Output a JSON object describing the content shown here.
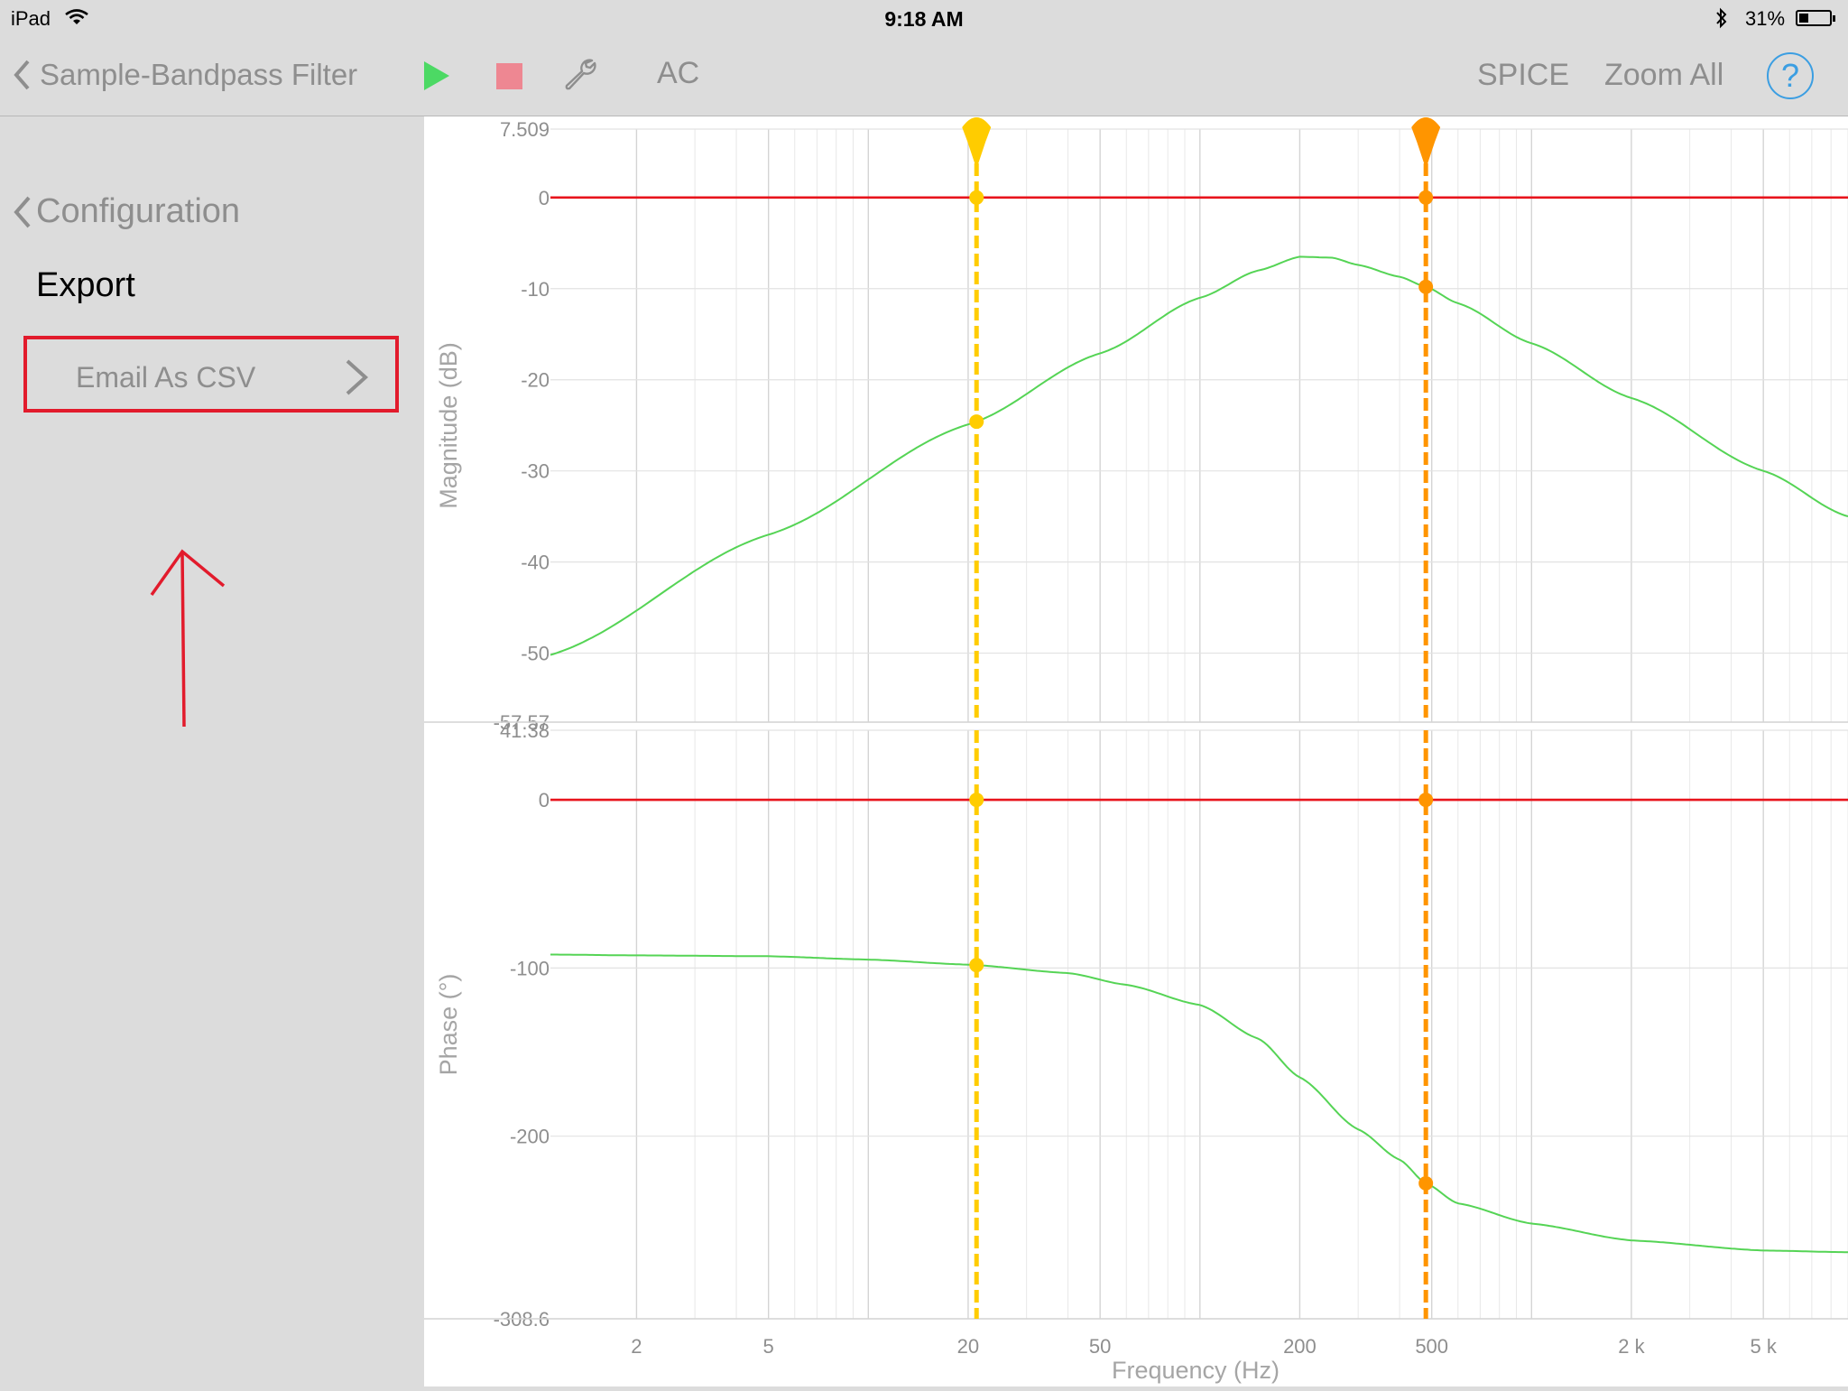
{
  "status_bar": {
    "device": "iPad",
    "time": "9:18 AM",
    "battery_percent": "31%"
  },
  "nav": {
    "back_label": "Sample-Bandpass Filter",
    "mode_label": "AC",
    "spice_label": "SPICE",
    "zoom_label": "Zoom All",
    "help_symbol": "?"
  },
  "sidebar": {
    "back_label": "Configuration",
    "section_title": "Export",
    "items": [
      {
        "label": "Email As CSV"
      }
    ]
  },
  "colors": {
    "trace": "#55d455",
    "zero_line": "#e8141c",
    "cursor_1": "#ffcc00",
    "cursor_2": "#ff9500",
    "annotation": "#e21b2c",
    "accent": "#3b9ee2"
  },
  "icons": {
    "back": "chevron-left-icon",
    "run": "play-icon",
    "stop": "stop-icon",
    "settings": "wrench-icon",
    "help": "question-circle-icon",
    "menu_chevron": "chevron-right-icon"
  },
  "chart_data": [
    {
      "type": "line",
      "ylabel": "Magnitude (dB)",
      "xlabel": "Frequency (Hz)",
      "xscale": "log",
      "xlim": [
        1.1,
        9000
      ],
      "ylim": [
        -57.57,
        7.509
      ],
      "y_ticks": [
        7.509,
        0,
        -10,
        -20,
        -30,
        -40,
        -50,
        -57.57
      ],
      "y_tick_labels": [
        "7.509",
        "0",
        "-10",
        "-20",
        "-30",
        "-40",
        "-50",
        "-57.57"
      ],
      "grid": true,
      "reference_line_y": 0,
      "cursors_x": [
        21.2,
        480
      ],
      "series": [
        {
          "x": [
            1.1,
            5,
            20,
            50,
            100,
            150,
            200,
            250,
            300,
            400,
            480,
            600,
            1000,
            2000,
            5000,
            9000
          ],
          "y": [
            -50.2,
            -37.0,
            -24.9,
            -17.1,
            -11.0,
            -8.0,
            -6.5,
            -6.6,
            -7.4,
            -8.7,
            -9.8,
            -11.6,
            -16.0,
            -22.0,
            -30.0,
            -35.0
          ]
        }
      ]
    },
    {
      "type": "line",
      "ylabel": "Phase (°)",
      "xlabel": "Frequency (Hz)",
      "xscale": "log",
      "xlim": [
        1.1,
        9000
      ],
      "ylim": [
        -308.6,
        41.38
      ],
      "y_ticks": [
        41.38,
        0,
        -100,
        -200,
        -308.6
      ],
      "y_tick_labels": [
        "41.38",
        "0",
        "-100",
        "-200",
        "-308.6"
      ],
      "x_ticks": [
        2,
        5,
        20,
        50,
        200,
        500,
        2000,
        5000
      ],
      "x_tick_labels": [
        "2",
        "5",
        "20",
        "50",
        "200",
        "500",
        "2 k",
        "5 k"
      ],
      "grid": true,
      "reference_line_y": 0,
      "cursors_x": [
        21.2,
        480
      ],
      "series": [
        {
          "x": [
            1.1,
            2,
            5,
            10,
            20,
            40,
            60,
            100,
            150,
            200,
            300,
            400,
            480,
            600,
            1000,
            2000,
            5000,
            9000
          ],
          "y": [
            -92,
            -92.5,
            -93,
            -95,
            -98,
            -103,
            -110,
            -122,
            -142,
            -165,
            -196,
            -214,
            -228,
            -240,
            -252,
            -262,
            -268,
            -269
          ]
        }
      ]
    }
  ]
}
